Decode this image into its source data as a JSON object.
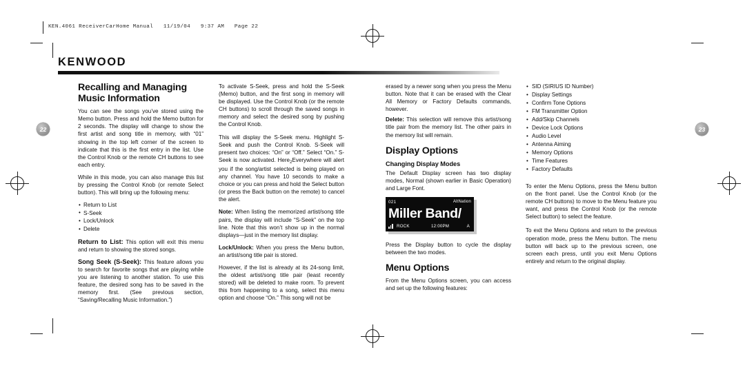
{
  "header": {
    "slug": "KEN.4061 ReceiverCarHome Manual   11/19/04   9:37 AM   Page 22",
    "brand": "KENWOOD"
  },
  "page_badges": {
    "left": "22",
    "right": "23"
  },
  "columns": {
    "col1": {
      "heading_line1": "Recalling and Managing",
      "heading_line2": "Music Information",
      "p1": "You can see the songs you’ve stored using the Memo button. Press and hold the Memo button for 2 seconds. The display will change to show the first artist and song title in memory, with “01” showing in the top left corner of the screen to indicate that this is the first entry in the list. Use the Control Knob or the remote CH buttons to see each entry.",
      "p2": "While in this mode, you can also manage this list by pressing the Control Knob (or remote Select button). This will bring up the following menu:",
      "menu_items": [
        "Return to List",
        "S-Seek",
        "Lock/Unlock",
        "Delete"
      ],
      "p3_run": "Return to List:",
      "p3_body": " This option will exit this menu and return to showing the stored songs.",
      "p4_run": "Song Seek (S-Seek):",
      "p4_body": " This feature allows you to search for favorite songs that are playing while you are listening to another station. To use this feature, the desired song has to be saved in the memory first. (See previous section, “Saving/Recalling Music Information.”)"
    },
    "col2": {
      "p1": "To activate S-Seek, press and hold the S-Seek (Memo) button, and the first song in memory will be displayed. Use the Control Knob (or the remote CH buttons) to scroll through the saved songs in memory and select the desired song by pushing the Control Knob.",
      "p2_a": "This will display the S-Seek menu. Highlight S-Seek and push the Control Knob. S-Seek will present two choices: “On” or “Off.” Select “On.” S-Seek is now activated. Here",
      "p2_sub": "2",
      "p2_b": "Everywhere will alert you if the song/artist selected is being played on any channel. You have 10 seconds to make a choice or you can press and hold the Select button (or press the Back button on the remote) to cancel the alert.",
      "p3_run": "Note:",
      "p3_body": " When listing the memorized artist/song title pairs, the display will include “S-Seek” on the top line. Note that this won’t show up in the normal displays—just in the memory list display.",
      "p4_run": "Lock/Unlock:",
      "p4_body": " When you press the Menu button, an artist/song title pair is stored.",
      "p5": "However, if the list is already at its 24-song limit, the oldest artist/song title pair (least recently stored) will be deleted to make room. To prevent this from happening to a song, select this menu option and choose “On.” This song will not be"
    },
    "col3": {
      "p1": "erased by a newer song when you press the Menu button. Note that it can be erased with the Clear All Memory or Factory Defaults commands, however.",
      "p2_run": "Delete:",
      "p2_body": " This selection will remove this artist/song title pair from the memory list. The other pairs in the memory list will remain.",
      "heading": "Display Options",
      "subheading": "Changing Display Modes",
      "p3": "The Default Display screen has two display modes, Normal (shown earlier in Basic Operation) and Large Font.",
      "p4": "Press the Display button to cycle the display between the two modes.",
      "heading2": "Menu Options",
      "p5": "From the Menu Options screen, you can access and set up the following features:"
    },
    "col4": {
      "features": [
        "SID (SIRIUS ID Number)",
        "Display Settings",
        "Confirm Tone Options",
        "FM Transmitter Option",
        "Add/Skip Channels",
        "Device Lock Options",
        "Audio Level",
        "Antenna Aiming",
        "Memory Options",
        "Time Features",
        "Factory Defaults"
      ],
      "p1": "To enter the Menu Options, press the Menu button on the front panel. Use the Control Knob (or the remote CH buttons) to move to the Menu feature you want, and press the Control Knob (or the remote Select button) to select the feature.",
      "p2": "To exit the Menu Options and return to the previous operation mode, press the Menu button. The menu button will back up to the previous screen, one screen each press, until you exit Menu Options entirely and return to the original display."
    }
  },
  "lcd_figure": {
    "channel": "021",
    "band_name": "AltNation",
    "main_text": "Miller Band/",
    "genre": "ROCK",
    "time": "12:00PM",
    "sat": "A"
  }
}
